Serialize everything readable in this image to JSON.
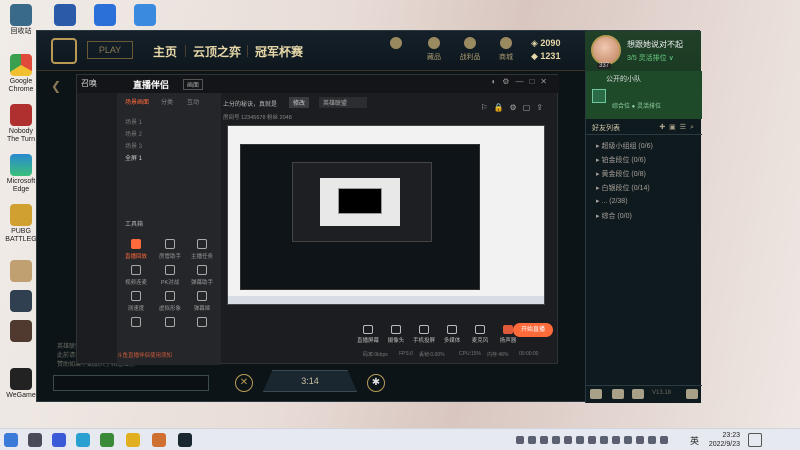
{
  "desktop": {
    "icons": [
      "回收站",
      "Google Chrome",
      "Nobody The Turn",
      "Microsoft Edge",
      "PUBG BATTLEG",
      "",
      "",
      "",
      "WeGame"
    ]
  },
  "lol": {
    "play_label": "PLAY",
    "nav": [
      "主页",
      "云顶之弈",
      "冠军杯赛"
    ],
    "top_icons": [
      "",
      "藏品",
      "战利品",
      "商城"
    ],
    "currency": {
      "be": "2090",
      "rp": "1231"
    },
    "profile": {
      "name": "想跟她说对不起",
      "status": "3/5 灵活排位 ∨",
      "level": "337"
    },
    "party": {
      "title": "公开的小队",
      "status": "综合位 ● 灵活排位"
    },
    "friends": {
      "title": "好友列表",
      "groups": [
        "▸ 超级小组组 (0/6)",
        "▸ 铂金段位 (0/6)",
        "▸ 黄金段位 (0/8)",
        "▸ 白银段位 (0/14)",
        "▸ ... (2/38)",
        "▸ 综合 (0/0)"
      ]
    },
    "version": "V13.18",
    "timer": "3:14",
    "chat_lines": [
      "英雄联盟官方常规注意",
      "此前请尊法方为很好的",
      "赞助如果不如加入了和适当前"
    ]
  },
  "stream": {
    "window_name": "召唤",
    "app_name": "直播伴侣",
    "tag": "画面",
    "tabs": [
      "场景画面",
      "分类",
      "互动"
    ],
    "scenes": [
      "场景 1",
      "场景 2",
      "场景 3",
      "全屏 1"
    ],
    "tools_title": "工具箱",
    "tools": [
      "直播回放",
      "房管助手",
      "主播任务",
      "视频连麦",
      "PK对战",
      "弹幕助手",
      "测速度",
      "虚拟形象",
      "弹幕姬",
      "",
      "",
      ""
    ],
    "notice": "斗鱼直播伴侣使用须知",
    "head_title": "上分的秘诀，真就是",
    "edit_btn": "修改",
    "category": "英雄联盟",
    "meta": "房间号 12345678   粉丝 2048",
    "bottom_tools": [
      "直播屏幕",
      "摄像头",
      "手机投屏",
      "多媒体",
      "麦克风",
      "扬声器"
    ],
    "go_live": "开始直播",
    "stats": [
      "码率:0kbps",
      "FPS:0",
      "丢帧:0.00%",
      "CPU:15%",
      "内存:48%",
      "00:00:00"
    ]
  },
  "taskbar": {
    "lang": "英",
    "time": "23:23",
    "date": "2022/9/23"
  }
}
